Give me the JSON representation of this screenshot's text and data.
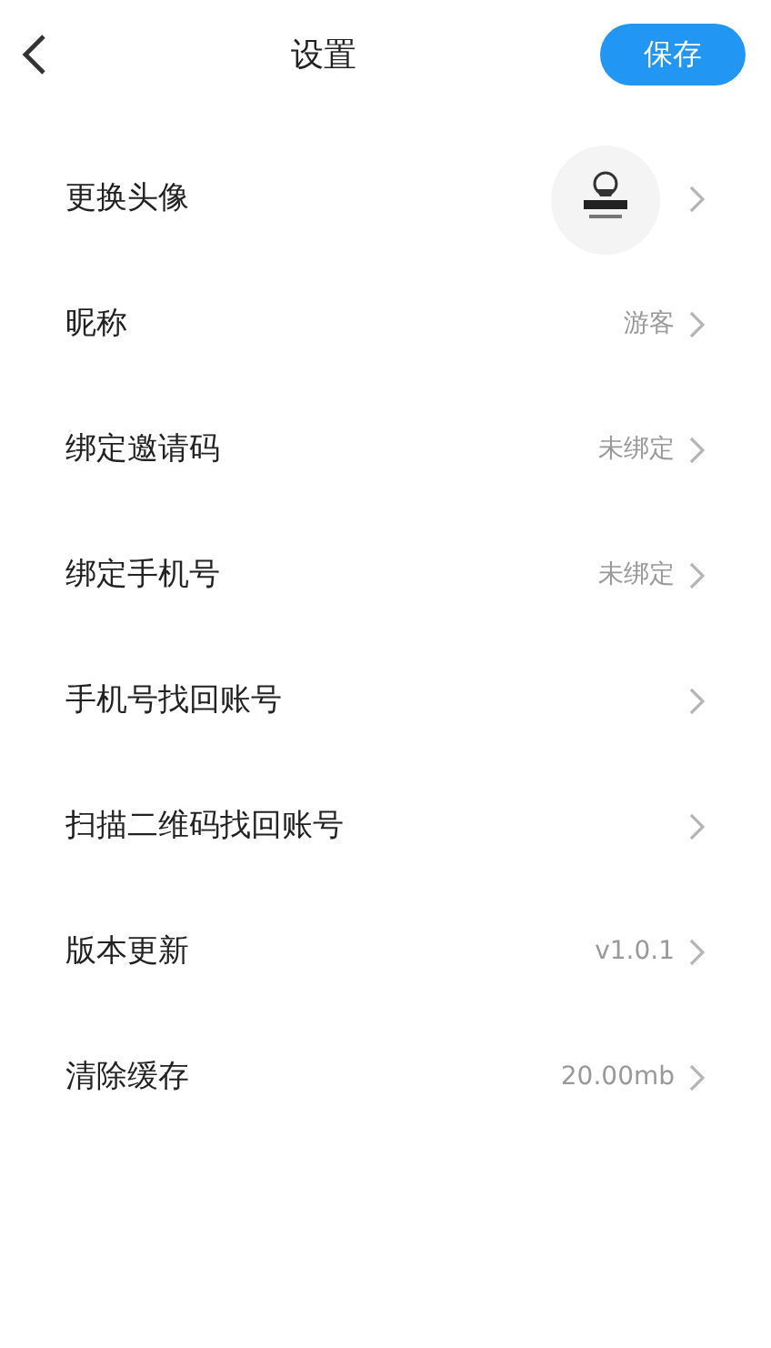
{
  "header": {
    "title": "设置",
    "save_button": "保存"
  },
  "rows": [
    {
      "kind": "avatar",
      "label": "更换头像"
    },
    {
      "kind": "value",
      "label": "昵称",
      "value": "游客"
    },
    {
      "kind": "value",
      "label": "绑定邀请码",
      "value": "未绑定"
    },
    {
      "kind": "value",
      "label": "绑定手机号",
      "value": "未绑定"
    },
    {
      "kind": "plain",
      "label": "手机号找回账号"
    },
    {
      "kind": "plain",
      "label": "扫描二维码找回账号"
    },
    {
      "kind": "value",
      "label": "版本更新",
      "value": "v1.0.1"
    },
    {
      "kind": "value",
      "label": "清除缓存",
      "value": "20.00mb"
    }
  ]
}
